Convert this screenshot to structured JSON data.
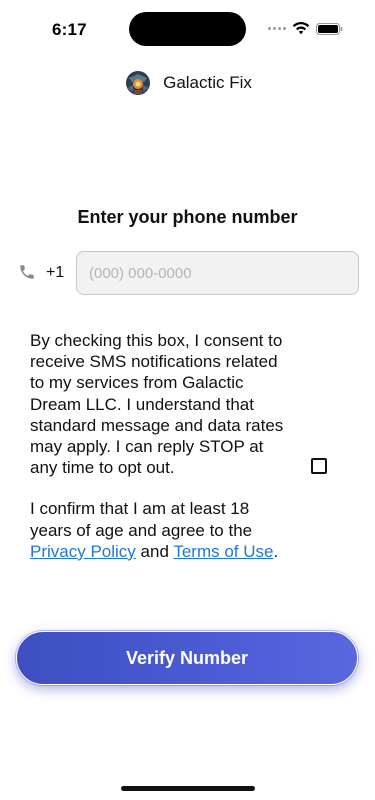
{
  "status_bar": {
    "time": "6:17"
  },
  "app": {
    "name": "Galactic Fix",
    "logo_icon": "galactic-fix-logo"
  },
  "page": {
    "title": "Enter your phone number"
  },
  "phone": {
    "icon": "phone-icon",
    "country_code": "+1",
    "placeholder": "(000) 000-0000",
    "value": ""
  },
  "consent": {
    "paragraph1": "By checking this box, I consent to receive SMS notifications related to my services from Galactic Dream LLC. I understand that standard message and data rates may apply. I can reply STOP at any time to opt out.",
    "paragraph2_prefix": "I confirm that I am at least 18 years of age and agree to the ",
    "privacy_link": "Privacy Policy",
    "and_text": " and ",
    "terms_link": "Terms of Use",
    "suffix": ".",
    "checked": false
  },
  "actions": {
    "verify_label": "Verify Number"
  },
  "colors": {
    "accent": "#4656cf",
    "link": "#1f78d1"
  }
}
